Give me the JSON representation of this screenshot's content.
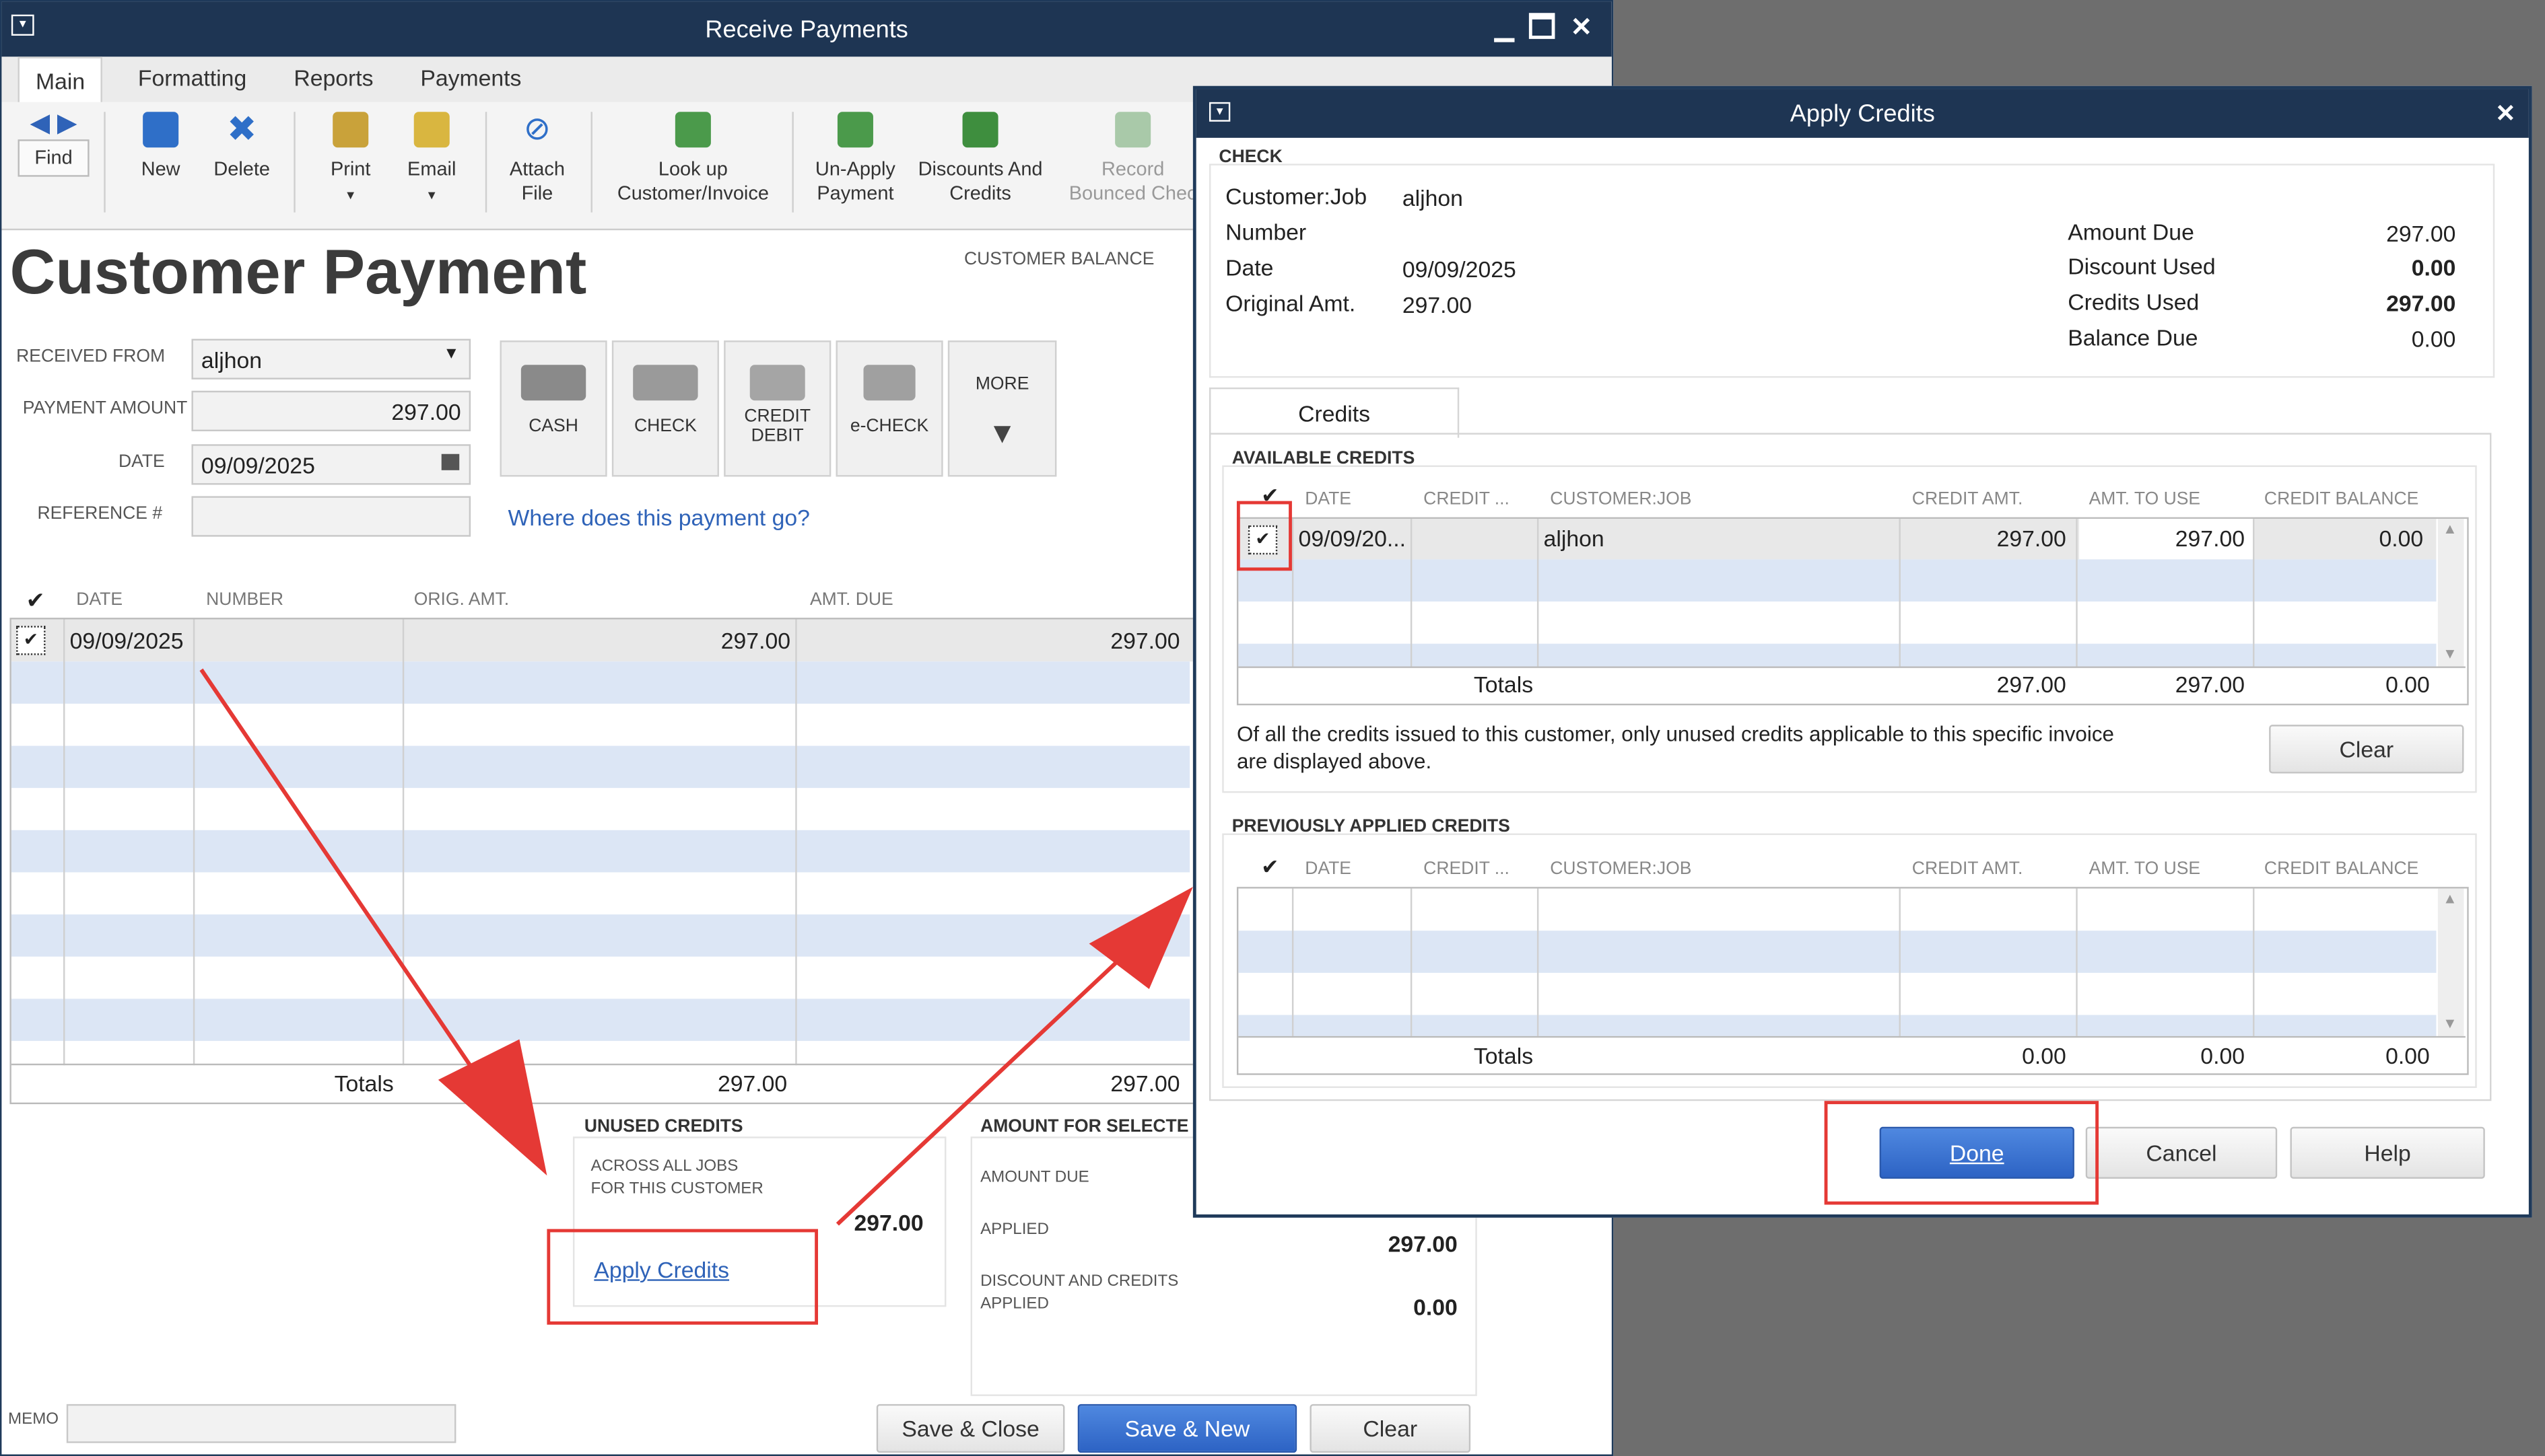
{
  "main_window": {
    "title": "Receive Payments",
    "tabs": [
      "Main",
      "Formatting",
      "Reports",
      "Payments"
    ],
    "toolbar": {
      "find": "Find",
      "new": "New",
      "delete": "Delete",
      "print": "Print",
      "email": "Email",
      "attach_1": "Attach",
      "attach_2": "File",
      "lookup_1": "Look up",
      "lookup_2": "Customer/Invoice",
      "unapply_1": "Un-Apply",
      "unapply_2": "Payment",
      "discounts_1": "Discounts And",
      "discounts_2": "Credits",
      "record_1": "Record",
      "record_2": "Bounced Chec"
    },
    "heading": "Customer Payment",
    "customer_balance_label": "CUSTOMER BALANCE",
    "form": {
      "received_from_label": "RECEIVED FROM",
      "received_from": "aljhon",
      "payment_amount_label": "PAYMENT AMOUNT",
      "payment_amount": "297.00",
      "date_label": "DATE",
      "date": "09/09/2025",
      "reference_label": "REFERENCE #",
      "reference": ""
    },
    "payment_methods": {
      "cash": "CASH",
      "check": "CHECK",
      "credit_1": "CREDIT",
      "credit_2": "DEBIT",
      "echeck": "e-CHECK",
      "more": "MORE"
    },
    "where_link": "Where does this payment go?",
    "grid": {
      "headers": [
        "DATE",
        "NUMBER",
        "ORIG. AMT.",
        "AMT. DUE"
      ],
      "row": {
        "date": "09/09/2025",
        "number": "",
        "orig_amt": "297.00",
        "amt_due": "297.00"
      },
      "totals_label": "Totals",
      "totals_orig": "297.00",
      "totals_due": "297.00"
    },
    "unused_credits": {
      "title": "UNUSED CREDITS",
      "line1": "ACROSS ALL JOBS",
      "line2": "FOR THIS CUSTOMER",
      "amount": "297.00",
      "link": "Apply Credits"
    },
    "amount_selected": {
      "title": "AMOUNT FOR SELECTE",
      "amount_due_label": "AMOUNT DUE",
      "applied_label": "APPLIED",
      "applied": "297.00",
      "discount_label_1": "DISCOUNT AND CREDITS",
      "discount_label_2": "APPLIED",
      "discount": "0.00"
    },
    "memo_label": "MEMO",
    "buttons": {
      "save_close": "Save & Close",
      "save_new": "Save & New",
      "clear": "Clear"
    }
  },
  "apply_credits": {
    "title": "Apply Credits",
    "check_section": "CHECK",
    "customer_job_label": "Customer:Job",
    "customer_job": "aljhon",
    "number_label": "Number",
    "date_label": "Date",
    "date": "09/09/2025",
    "orig_amt_label": "Original Amt.",
    "orig_amt": "297.00",
    "amount_due_label": "Amount Due",
    "amount_due": "297.00",
    "discount_used_label": "Discount Used",
    "discount_used": "0.00",
    "credits_used_label": "Credits Used",
    "credits_used": "297.00",
    "balance_due_label": "Balance Due",
    "balance_due": "0.00",
    "tab": "Credits",
    "available_title": "AVAILABLE CREDITS",
    "columns": [
      "DATE",
      "CREDIT ...",
      "CUSTOMER:JOB",
      "CREDIT AMT.",
      "AMT. TO USE",
      "CREDIT BALANCE"
    ],
    "available_row": {
      "date": "09/09/20...",
      "credit": "",
      "customer_job": "aljhon",
      "credit_amt": "297.00",
      "amt_to_use": "297.00",
      "credit_balance": "0.00"
    },
    "available_totals": {
      "label": "Totals",
      "credit_amt": "297.00",
      "amt_to_use": "297.00",
      "credit_balance": "0.00"
    },
    "info_line1": "Of all the credits issued to this customer, only unused credits applicable to this specific invoice",
    "info_line2": "are displayed above.",
    "clear_button": "Clear",
    "previous_title": "PREVIOUSLY APPLIED CREDITS",
    "previous_totals": {
      "label": "Totals",
      "credit_amt": "0.00",
      "amt_to_use": "0.00",
      "credit_balance": "0.00"
    },
    "buttons": {
      "done": "Done",
      "cancel": "Cancel",
      "help": "Help"
    }
  },
  "colors": {
    "title_bar": "#1e3553",
    "accent_blue": "#2d63c4",
    "annotation_red": "#e53935",
    "grid_stripe": "#dce6f5"
  }
}
